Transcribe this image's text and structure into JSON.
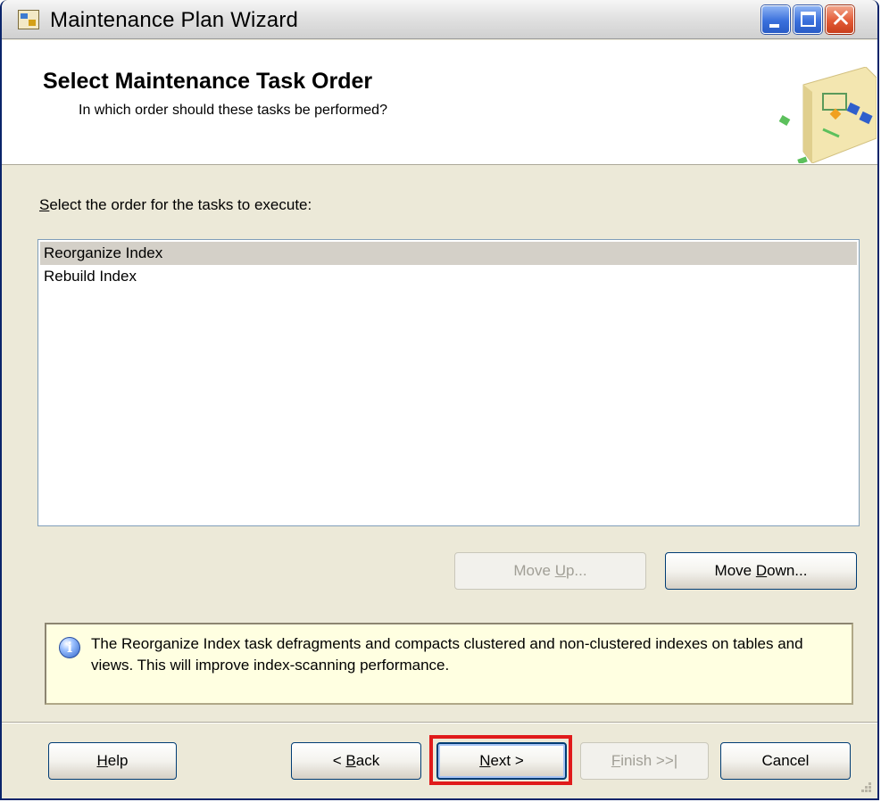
{
  "window": {
    "title": "Maintenance Plan Wizard",
    "close_glyph": "✕",
    "icons": {
      "app": "wizard-app-icon",
      "min": "minimize-icon",
      "max": "maximize-icon",
      "close": "close-icon"
    }
  },
  "header": {
    "title": "Select Maintenance Task Order",
    "subtitle": "In which order should these tasks be performed?"
  },
  "body": {
    "list_label_accel": "S",
    "list_label_rest": "elect the order for the tasks to execute:",
    "tasks": [
      {
        "label": "Reorganize Index",
        "selected": true
      },
      {
        "label": "Rebuild Index",
        "selected": false
      }
    ],
    "move_up": {
      "pre": "Move ",
      "accel": "U",
      "post": "p...",
      "enabled": false
    },
    "move_down": {
      "pre": "Move ",
      "accel": "D",
      "post": "own...",
      "enabled": true
    }
  },
  "info": {
    "icon": "info-icon",
    "icon_glyph": "i",
    "text": "The Reorganize Index task defragments and compacts clustered and non-clustered indexes on tables and views. This will improve index-scanning performance."
  },
  "footer": {
    "help": {
      "pre": "",
      "accel": "H",
      "post": "elp"
    },
    "back": {
      "pre": "< ",
      "accel": "B",
      "post": "ack"
    },
    "next": {
      "pre": "",
      "accel": "N",
      "post": "ext >"
    },
    "finish": {
      "pre": "",
      "accel": "F",
      "post": "inish >>|",
      "enabled": false
    },
    "cancel": {
      "label": "Cancel"
    }
  },
  "colors": {
    "highlight": "#e01b1b",
    "selection": "#d4d0c8",
    "info_bg": "#ffffe1"
  }
}
